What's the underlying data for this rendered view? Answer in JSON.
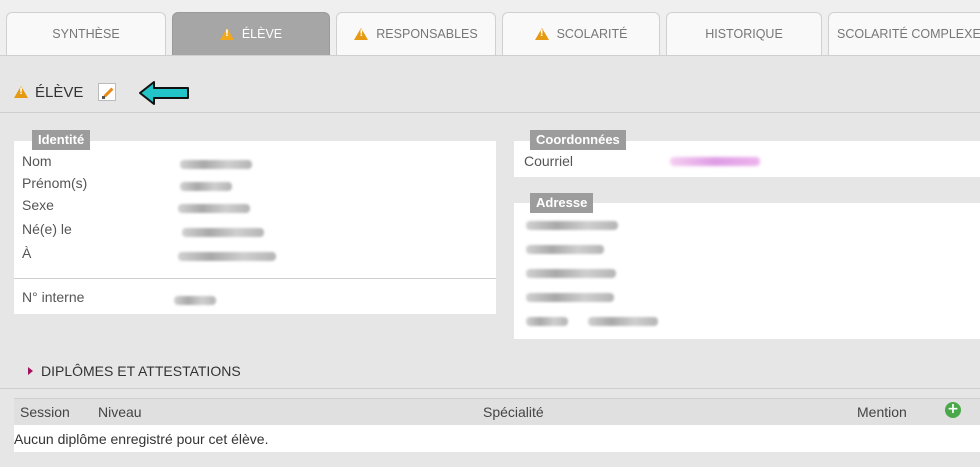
{
  "tabs": [
    {
      "label": "SYNTHÈSE",
      "warning": false,
      "active": false
    },
    {
      "label": "ÉLÈVE",
      "warning": true,
      "active": true
    },
    {
      "label": "RESPONSABLES",
      "warning": true,
      "active": false
    },
    {
      "label": "SCOLARITÉ",
      "warning": true,
      "active": false
    },
    {
      "label": "HISTORIQUE",
      "warning": false,
      "active": false
    },
    {
      "label": "SCOLARITÉ COMPLEXE",
      "warning": false,
      "active": false
    }
  ],
  "section": {
    "title": "ÉLÈVE"
  },
  "identite": {
    "legend": "Identité",
    "labels": [
      "Nom",
      "Prénom(s)",
      "Sexe",
      "Né(e) le",
      "À"
    ],
    "interne_label": "N° interne"
  },
  "coordonnees": {
    "legend": "Coordonnées",
    "courriel_label": "Courriel"
  },
  "adresse": {
    "legend": "Adresse"
  },
  "diplomes": {
    "title": "DIPLÔMES ET ATTESTATIONS",
    "columns": {
      "session": "Session",
      "niveau": "Niveau",
      "specialite": "Spécialité",
      "mention": "Mention"
    },
    "empty": "Aucun diplôme enregistré pour cet élève."
  },
  "colors": {
    "accent_warning": "#e59a12",
    "arrow": "#22c4c8",
    "legend_bg": "#9c9c9c",
    "add": "#4aa84a"
  }
}
